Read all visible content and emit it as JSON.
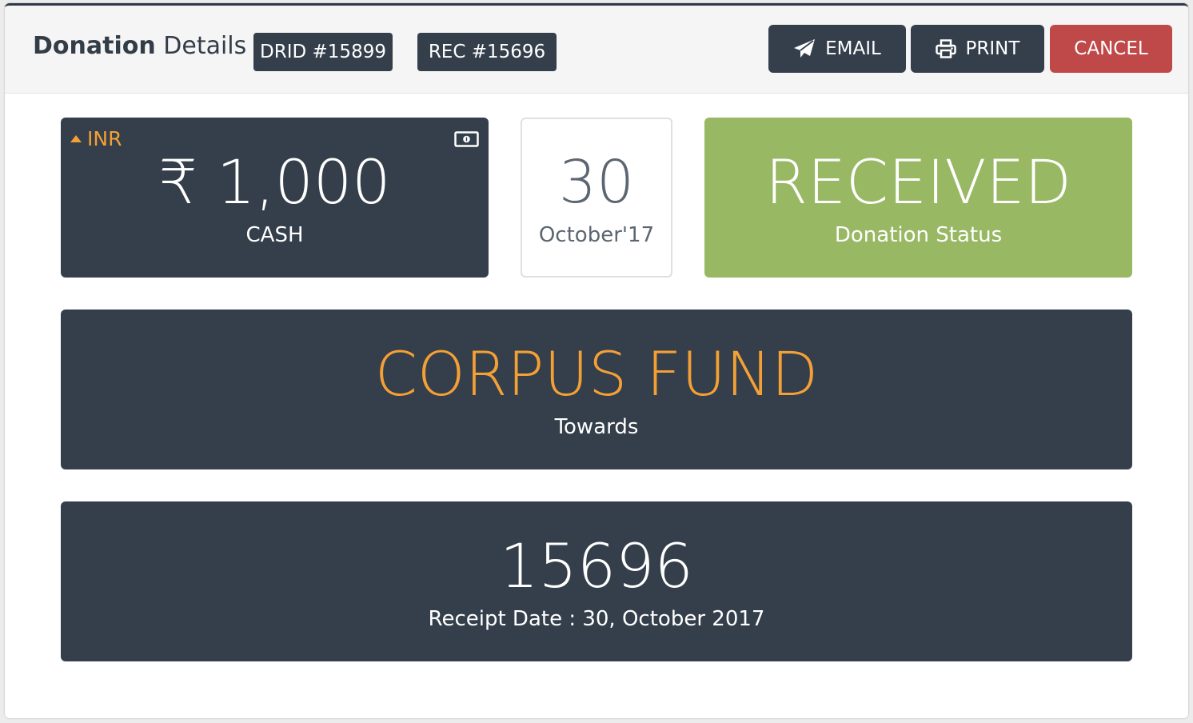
{
  "header": {
    "title_bold": "Donation",
    "title_rest": " Details",
    "drid_badge": "DRID #15899",
    "rec_badge": "REC #15696",
    "email_label": "EMAIL",
    "print_label": "PRINT",
    "cancel_label": "CANCEL"
  },
  "amount": {
    "currency": "INR",
    "currency_icon": "caret-up-icon",
    "value": "₹ 1,000",
    "mode": "CASH",
    "mode_icon": "money-bill-icon"
  },
  "date_card": {
    "day": "30",
    "month_year": "October'17"
  },
  "status": {
    "value": "RECEIVED",
    "label": "Donation Status"
  },
  "towards": {
    "value": "CORPUS FUND",
    "label": "Towards"
  },
  "receipt": {
    "number": "15696",
    "date_text": "Receipt Date : 30, October 2017"
  },
  "colors": {
    "dark": "#343f4b",
    "accent_orange": "#f4a035",
    "status_green": "#98b863",
    "cancel_red": "#bf4848"
  }
}
